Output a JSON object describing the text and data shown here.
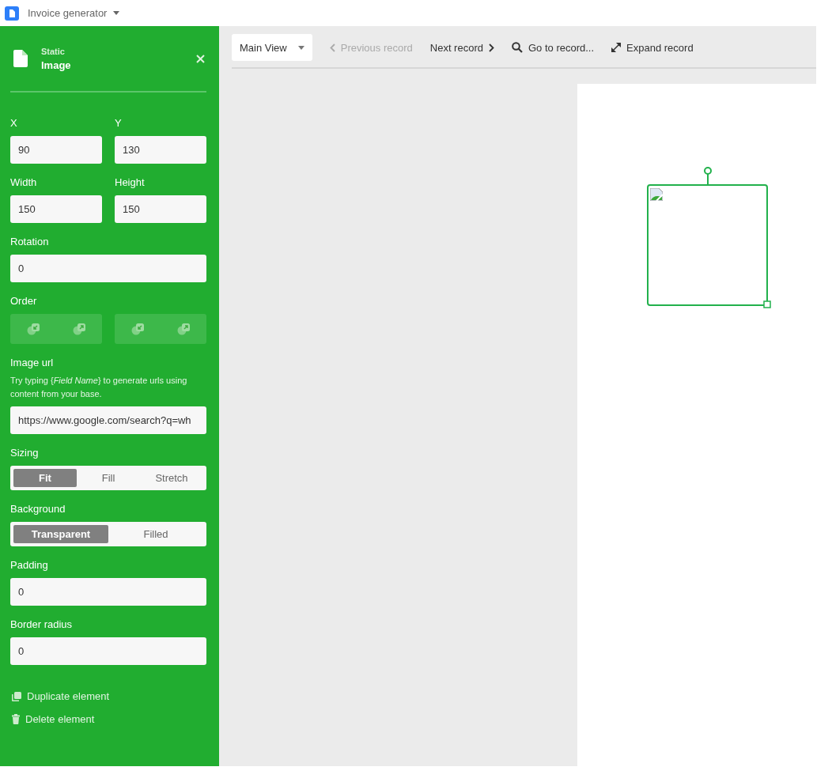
{
  "app": {
    "title": "Invoice generator"
  },
  "panel": {
    "type_label": "Static",
    "element_name": "Image",
    "rows": [
      [
        {
          "label": "X",
          "value": "90"
        },
        {
          "label": "Y",
          "value": "130"
        }
      ],
      [
        {
          "label": "Width",
          "value": "150"
        },
        {
          "label": "Height",
          "value": "150"
        }
      ],
      [
        {
          "label": "Rotation",
          "value": "0"
        }
      ]
    ],
    "order": {
      "label": "Order",
      "disabled": true
    },
    "image_url": {
      "label": "Image url",
      "hint": "Try typing {*Field Name*} to generate urls using content from your base.",
      "value": "https://www.google.com/search?q=wh"
    },
    "segments": [
      {
        "label": "Sizing",
        "options": [
          {
            "label": "Fit",
            "selected": true
          },
          {
            "label": "Fill",
            "selected": false
          },
          {
            "label": "Stretch",
            "selected": false
          }
        ]
      },
      {
        "label": "Background",
        "options": [
          {
            "label": "Transparent",
            "selected": true
          },
          {
            "label": "Filled",
            "selected": false
          }
        ]
      }
    ],
    "bottom_fields": [
      {
        "label": "Padding",
        "value": "0"
      },
      {
        "label": "Border radius",
        "value": "0"
      }
    ],
    "actions": [
      {
        "kind": "duplicate",
        "label": "Duplicate element"
      },
      {
        "kind": "delete",
        "label": "Delete element"
      }
    ]
  },
  "toolbar": {
    "view": "Main View",
    "buttons": [
      {
        "kind": "previous",
        "label": "Previous record",
        "disabled": true
      },
      {
        "kind": "next",
        "label": "Next record",
        "disabled": false
      },
      {
        "kind": "search",
        "label": "Go to record...",
        "disabled": false
      },
      {
        "kind": "expand",
        "label": "Expand record",
        "disabled": false
      }
    ]
  }
}
